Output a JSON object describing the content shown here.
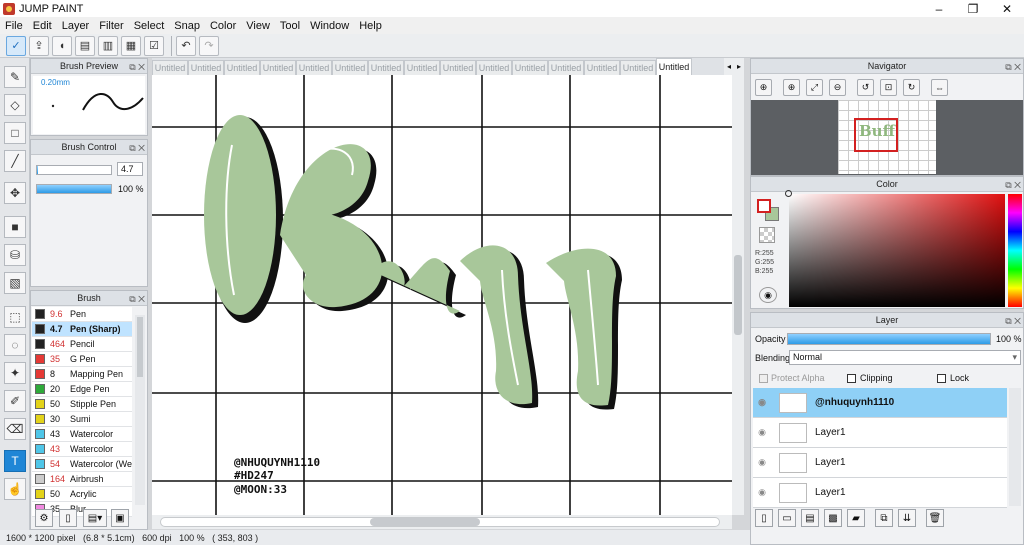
{
  "app": {
    "title": "JUMP PAINT"
  },
  "menu": [
    "File",
    "Edit",
    "Layer",
    "Filter",
    "Select",
    "Snap",
    "Color",
    "View",
    "Tool",
    "Window",
    "Help"
  ],
  "panels": {
    "brush_preview": {
      "title": "Brush Preview",
      "size": "0.20mm"
    },
    "brush_control": {
      "title": "Brush Control",
      "size_value": "4.7",
      "opacity_value": "100 %",
      "size_fill": 0.02,
      "opacity_fill": 1.0
    },
    "brush": {
      "title": "Brush",
      "items": [
        {
          "size": "9.6",
          "name": "Pen",
          "color": "#222222",
          "red": true
        },
        {
          "size": "4.7",
          "name": "Pen (Sharp)",
          "color": "#222222",
          "red": false,
          "selected": true
        },
        {
          "size": "464",
          "name": "Pencil",
          "color": "#222222",
          "red": true
        },
        {
          "size": "35",
          "name": "G Pen",
          "color": "#e53935",
          "red": true
        },
        {
          "size": "8",
          "name": "Mapping Pen",
          "color": "#e53935",
          "red": false
        },
        {
          "size": "20",
          "name": "Edge Pen",
          "color": "#2eaa3a",
          "red": false
        },
        {
          "size": "50",
          "name": "Stipple Pen",
          "color": "#e3d31a",
          "red": false
        },
        {
          "size": "30",
          "name": "Sumi",
          "color": "#e3d31a",
          "red": false
        },
        {
          "size": "43",
          "name": "Watercolor",
          "color": "#4fc6e8",
          "red": false
        },
        {
          "size": "43",
          "name": "Watercolor",
          "color": "#4fc6e8",
          "red": true
        },
        {
          "size": "54",
          "name": "Watercolor (We",
          "color": "#4fc6e8",
          "red": true
        },
        {
          "size": "164",
          "name": "Airbrush",
          "color": "#cccccc",
          "red": true
        },
        {
          "size": "50",
          "name": "Acrylic",
          "color": "#e3d31a",
          "red": false
        },
        {
          "size": "35",
          "name": "Blur",
          "color": "#f08ae0",
          "red": false
        }
      ]
    },
    "navigator": {
      "title": "Navigator"
    },
    "color": {
      "title": "Color",
      "r": "R:255",
      "g": "G:255",
      "b": "B:255"
    },
    "layer": {
      "title": "Layer",
      "opacity_label": "Opacity",
      "opacity_value": "100 %",
      "opacity_fill": 1.0,
      "blending_label": "Blending",
      "blending_value": "Normal",
      "protect_alpha": "Protect Alpha",
      "clipping": "Clipping",
      "lock": "Lock",
      "layers": [
        {
          "name": "@nhuquynh1110",
          "selected": true
        },
        {
          "name": "Layer1",
          "selected": false
        },
        {
          "name": "Layer1",
          "selected": false
        },
        {
          "name": "Layer1",
          "selected": false
        }
      ]
    }
  },
  "tabs": [
    "Untitled",
    "Untitled",
    "Untitled",
    "Untitled",
    "Untitled",
    "Untitled",
    "Untitled",
    "Untitled",
    "Untitled",
    "Untitled",
    "Untitled",
    "Untitled",
    "Untitled",
    "Untitled",
    "Untitled"
  ],
  "canvas": {
    "art_text": "Buff",
    "art_color": "#a8c79a",
    "credit_lines": [
      "@NHUQUYNH1110",
      "#HD247",
      "@MOON:33"
    ]
  },
  "status": {
    "text": "1600 * 1200 pixel   (6.8 * 5.1cm)   600 dpi   100 %   ( 353, 803 )"
  },
  "colors": {
    "accent": "#1f86d6",
    "selection": "#8fd0f6"
  }
}
